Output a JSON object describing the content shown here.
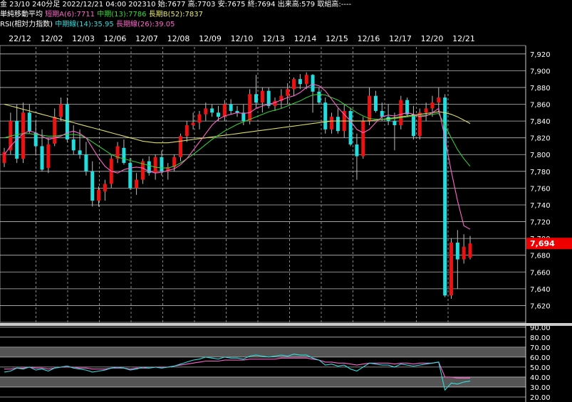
{
  "header": {
    "line1": {
      "symbol": "金 23/10 240分足",
      "datetime": "2022/12/21 04:00",
      "code": "202310",
      "open": "始:7677",
      "high": "高:7703",
      "low": "安:7675",
      "close": "終:7694",
      "volume": "出来高:579",
      "oi": "取組高:----"
    },
    "line2": {
      "label": "単純移動平均",
      "ma_short": "短期A(6):7711",
      "ma_mid": "中期(13):7786",
      "ma_long": "長期B(52):7837"
    },
    "line3": {
      "label": "RSI(相対力指数)",
      "rsi_mid": "中期線(14):35.95",
      "rsi_long": "長期線(26):39.05"
    }
  },
  "colors": {
    "up": "#ee1111",
    "down": "#22dddd",
    "ma_short": "#ff66cc",
    "ma_mid": "#33cc33",
    "ma_long": "#dddd66",
    "rsi_mid": "#33dddd",
    "rsi_long": "#ff66cc",
    "price_tag": "#ee0000"
  },
  "chart_data": {
    "type": "candlestick",
    "dates": [
      "22/12",
      "12/02",
      "12/03",
      "12/06",
      "12/07",
      "12/08",
      "12/09",
      "12/10",
      "12/13",
      "12/14",
      "12/15",
      "12/16",
      "12/17",
      "12/20",
      "12/21"
    ],
    "y_ticks": [
      "7,920",
      "7,900",
      "7,880",
      "7,860",
      "7,840",
      "7,820",
      "7,800",
      "7,780",
      "7,760",
      "7,740",
      "7,720",
      "7,700",
      "7,680",
      "7,660",
      "7,640",
      "7,620"
    ],
    "ylim": [
      7600,
      7930
    ],
    "last_price_label": "7,694",
    "last_price": 7694,
    "candles": [
      [
        7790,
        7808,
        7785,
        7803
      ],
      [
        7805,
        7850,
        7800,
        7840
      ],
      [
        7840,
        7860,
        7790,
        7795
      ],
      [
        7795,
        7862,
        7790,
        7850
      ],
      [
        7850,
        7860,
        7825,
        7828
      ],
      [
        7826,
        7840,
        7800,
        7810
      ],
      [
        7810,
        7830,
        7780,
        7782
      ],
      [
        7784,
        7820,
        7778,
        7812
      ],
      [
        7813,
        7855,
        7810,
        7845
      ],
      [
        7845,
        7868,
        7840,
        7860
      ],
      [
        7860,
        7868,
        7815,
        7818
      ],
      [
        7818,
        7835,
        7800,
        7805
      ],
      [
        7805,
        7830,
        7795,
        7800
      ],
      [
        7800,
        7815,
        7775,
        7780
      ],
      [
        7780,
        7792,
        7738,
        7745
      ],
      [
        7745,
        7762,
        7738,
        7758
      ],
      [
        7756,
        7770,
        7745,
        7765
      ],
      [
        7765,
        7800,
        7760,
        7795
      ],
      [
        7795,
        7815,
        7790,
        7810
      ],
      [
        7808,
        7818,
        7788,
        7790
      ],
      [
        7790,
        7796,
        7758,
        7760
      ],
      [
        7760,
        7778,
        7752,
        7770
      ],
      [
        7770,
        7795,
        7765,
        7792
      ],
      [
        7792,
        7798,
        7775,
        7778
      ],
      [
        7778,
        7800,
        7770,
        7797
      ],
      [
        7797,
        7805,
        7775,
        7780
      ],
      [
        7780,
        7790,
        7770,
        7785
      ],
      [
        7785,
        7800,
        7780,
        7797
      ],
      [
        7797,
        7825,
        7792,
        7822
      ],
      [
        7822,
        7840,
        7815,
        7835
      ],
      [
        7835,
        7850,
        7830,
        7838
      ],
      [
        7838,
        7852,
        7830,
        7848
      ],
      [
        7848,
        7862,
        7840,
        7855
      ],
      [
        7855,
        7860,
        7845,
        7850
      ],
      [
        7850,
        7858,
        7840,
        7845
      ],
      [
        7845,
        7865,
        7840,
        7860
      ],
      [
        7860,
        7866,
        7848,
        7852
      ],
      [
        7852,
        7858,
        7845,
        7850
      ],
      [
        7850,
        7860,
        7835,
        7840
      ],
      [
        7840,
        7878,
        7836,
        7872
      ],
      [
        7872,
        7895,
        7855,
        7862
      ],
      [
        7862,
        7880,
        7850,
        7876
      ],
      [
        7876,
        7880,
        7855,
        7858
      ],
      [
        7858,
        7868,
        7852,
        7864
      ],
      [
        7864,
        7878,
        7855,
        7870
      ],
      [
        7870,
        7885,
        7860,
        7878
      ],
      [
        7878,
        7892,
        7870,
        7890
      ],
      [
        7890,
        7896,
        7878,
        7884
      ],
      [
        7884,
        7898,
        7878,
        7895
      ],
      [
        7895,
        7896,
        7850,
        7875
      ],
      [
        7875,
        7880,
        7860,
        7862
      ],
      [
        7862,
        7868,
        7825,
        7830
      ],
      [
        7830,
        7850,
        7825,
        7845
      ],
      [
        7845,
        7855,
        7825,
        7828
      ],
      [
        7828,
        7860,
        7820,
        7852
      ],
      [
        7852,
        7856,
        7810,
        7812
      ],
      [
        7812,
        7825,
        7770,
        7798
      ],
      [
        7798,
        7845,
        7795,
        7840
      ],
      [
        7840,
        7880,
        7835,
        7870
      ],
      [
        7870,
        7876,
        7850,
        7852
      ],
      [
        7852,
        7862,
        7840,
        7845
      ],
      [
        7845,
        7860,
        7835,
        7840
      ],
      [
        7840,
        7850,
        7805,
        7835
      ],
      [
        7835,
        7870,
        7830,
        7865
      ],
      [
        7865,
        7868,
        7845,
        7848
      ],
      [
        7848,
        7858,
        7818,
        7822
      ],
      [
        7822,
        7855,
        7818,
        7850
      ],
      [
        7850,
        7862,
        7840,
        7855
      ],
      [
        7855,
        7870,
        7845,
        7862
      ],
      [
        7862,
        7880,
        7850,
        7868
      ],
      [
        7868,
        7872,
        7630,
        7632
      ],
      [
        7632,
        7700,
        7628,
        7695
      ],
      [
        7695,
        7710,
        7640,
        7675
      ],
      [
        7675,
        7705,
        7670,
        7690
      ],
      [
        7677,
        7703,
        7675,
        7694
      ]
    ],
    "ma_short": [
      7800,
      7810,
      7818,
      7825,
      7828,
      7826,
      7822,
      7818,
      7820,
      7822,
      7826,
      7828,
      7825,
      7820,
      7808,
      7796,
      7786,
      7780,
      7778,
      7782,
      7784,
      7785,
      7784,
      7780,
      7778,
      7779,
      7781,
      7783,
      7788,
      7795,
      7805,
      7815,
      7825,
      7835,
      7842,
      7846,
      7848,
      7850,
      7849,
      7850,
      7855,
      7858,
      7860,
      7862,
      7865,
      7868,
      7870,
      7874,
      7880,
      7884,
      7882,
      7876,
      7866,
      7856,
      7848,
      7840,
      7830,
      7826,
      7830,
      7838,
      7845,
      7847,
      7846,
      7848,
      7850,
      7848,
      7845,
      7846,
      7850,
      7855,
      7820,
      7780,
      7745,
      7715,
      7711
    ],
    "ma_mid": [
      7820,
      7822,
      7824,
      7825,
      7825,
      7824,
      7823,
      7822,
      7822,
      7823,
      7824,
      7824,
      7823,
      7820,
      7815,
      7810,
      7805,
      7800,
      7797,
      7795,
      7793,
      7791,
      7789,
      7787,
      7785,
      7784,
      7784,
      7786,
      7790,
      7795,
      7800,
      7806,
      7812,
      7818,
      7823,
      7828,
      7832,
      7836,
      7839,
      7842,
      7845,
      7848,
      7851,
      7853,
      7855,
      7858,
      7861,
      7864,
      7868,
      7871,
      7872,
      7871,
      7868,
      7865,
      7860,
      7855,
      7850,
      7846,
      7843,
      7842,
      7842,
      7842,
      7843,
      7844,
      7845,
      7846,
      7846,
      7847,
      7848,
      7849,
      7835,
      7820,
      7806,
      7795,
      7786
    ],
    "ma_long": [
      7860,
      7858,
      7856,
      7854,
      7852,
      7850,
      7848,
      7846,
      7844,
      7842,
      7840,
      7838,
      7836,
      7834,
      7832,
      7830,
      7828,
      7826,
      7824,
      7822,
      7820,
      7818,
      7816,
      7815,
      7814,
      7814,
      7814,
      7815,
      7816,
      7817,
      7818,
      7819,
      7820,
      7821,
      7822,
      7823,
      7824,
      7825,
      7826,
      7827,
      7828,
      7829,
      7830,
      7831,
      7832,
      7833,
      7834,
      7835,
      7836,
      7837,
      7838,
      7839,
      7840,
      7840,
      7840,
      7840,
      7840,
      7840,
      7840,
      7841,
      7842,
      7843,
      7844,
      7845,
      7846,
      7847,
      7848,
      7849,
      7850,
      7851,
      7850,
      7848,
      7845,
      7841,
      7837
    ],
    "rsi_panel": {
      "y_ticks": [
        "90.00",
        "80.00",
        "70.00",
        "60.00",
        "50.00",
        "40.00",
        "30.00",
        "20.00"
      ],
      "ylim": [
        15,
        92
      ],
      "shaded_bands": [
        [
          30,
          40
        ],
        [
          60,
          70
        ]
      ],
      "rsi_mid": [
        45,
        46,
        49,
        48,
        50,
        47,
        48,
        46,
        49,
        50,
        51,
        49,
        48,
        47,
        45,
        46,
        47,
        49,
        50,
        49,
        47,
        48,
        50,
        49,
        50,
        49,
        50,
        51,
        53,
        55,
        57,
        58,
        60,
        59,
        58,
        60,
        59,
        59,
        58,
        61,
        62,
        61,
        60,
        61,
        62,
        61,
        63,
        62,
        62,
        59,
        57,
        52,
        53,
        51,
        52,
        48,
        46,
        50,
        54,
        53,
        52,
        52,
        50,
        53,
        52,
        51,
        52,
        53,
        54,
        55,
        27,
        34,
        33,
        35,
        35.95
      ],
      "rsi_long": [
        48,
        48,
        49,
        49,
        50,
        49,
        49,
        48,
        49,
        50,
        50,
        50,
        49,
        49,
        48,
        48,
        48,
        49,
        49,
        49,
        48,
        49,
        49,
        49,
        50,
        50,
        50,
        51,
        52,
        53,
        54,
        55,
        56,
        56,
        56,
        57,
        57,
        57,
        57,
        58,
        58,
        58,
        58,
        58,
        59,
        59,
        59,
        59,
        59,
        58,
        57,
        55,
        55,
        54,
        54,
        53,
        52,
        53,
        54,
        54,
        54,
        54,
        53,
        54,
        54,
        53,
        54,
        54,
        54,
        55,
        40,
        40,
        39,
        39,
        39.05
      ]
    }
  }
}
